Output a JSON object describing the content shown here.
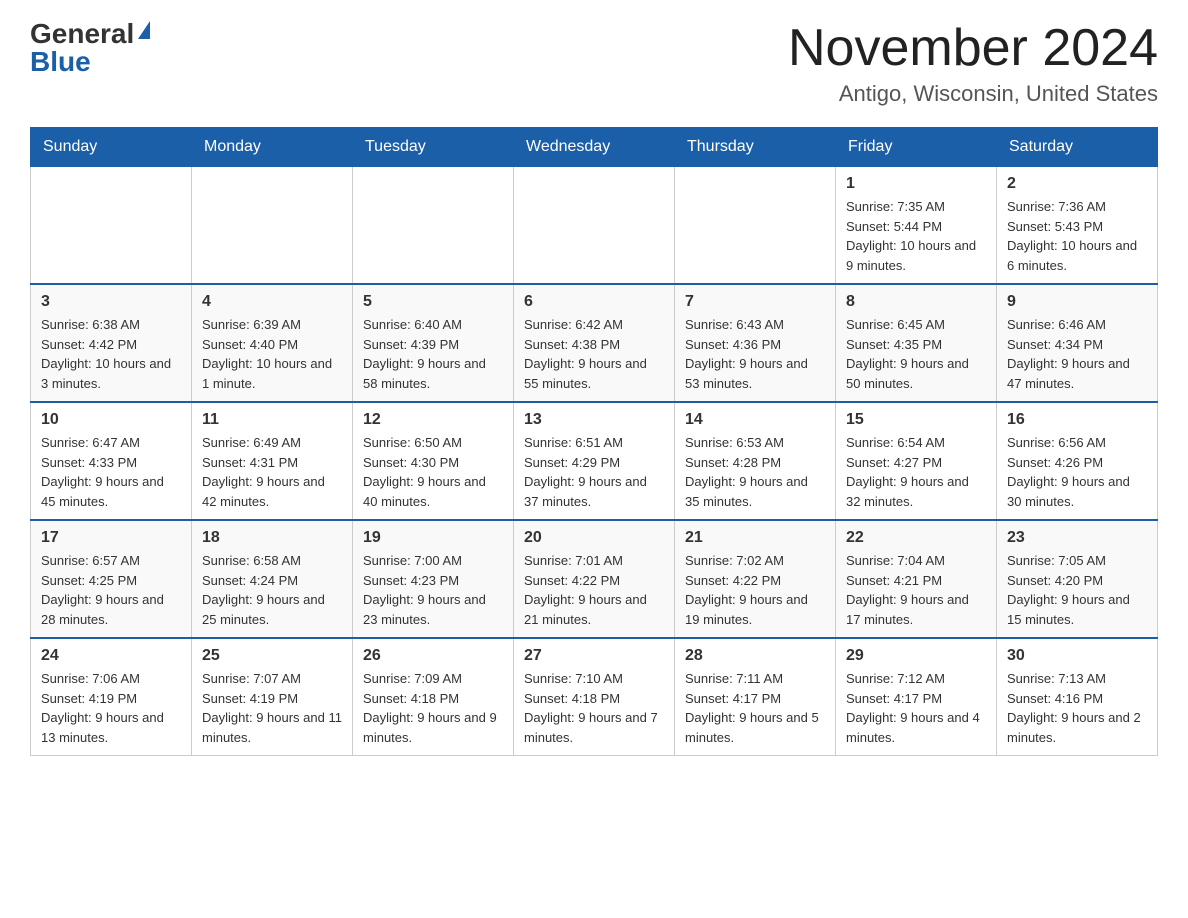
{
  "header": {
    "logo_general": "General",
    "logo_blue": "Blue",
    "month_title": "November 2024",
    "location": "Antigo, Wisconsin, United States"
  },
  "weekdays": [
    "Sunday",
    "Monday",
    "Tuesday",
    "Wednesday",
    "Thursday",
    "Friday",
    "Saturday"
  ],
  "weeks": [
    [
      {
        "day": "",
        "info": ""
      },
      {
        "day": "",
        "info": ""
      },
      {
        "day": "",
        "info": ""
      },
      {
        "day": "",
        "info": ""
      },
      {
        "day": "",
        "info": ""
      },
      {
        "day": "1",
        "info": "Sunrise: 7:35 AM\nSunset: 5:44 PM\nDaylight: 10 hours and 9 minutes."
      },
      {
        "day": "2",
        "info": "Sunrise: 7:36 AM\nSunset: 5:43 PM\nDaylight: 10 hours and 6 minutes."
      }
    ],
    [
      {
        "day": "3",
        "info": "Sunrise: 6:38 AM\nSunset: 4:42 PM\nDaylight: 10 hours and 3 minutes."
      },
      {
        "day": "4",
        "info": "Sunrise: 6:39 AM\nSunset: 4:40 PM\nDaylight: 10 hours and 1 minute."
      },
      {
        "day": "5",
        "info": "Sunrise: 6:40 AM\nSunset: 4:39 PM\nDaylight: 9 hours and 58 minutes."
      },
      {
        "day": "6",
        "info": "Sunrise: 6:42 AM\nSunset: 4:38 PM\nDaylight: 9 hours and 55 minutes."
      },
      {
        "day": "7",
        "info": "Sunrise: 6:43 AM\nSunset: 4:36 PM\nDaylight: 9 hours and 53 minutes."
      },
      {
        "day": "8",
        "info": "Sunrise: 6:45 AM\nSunset: 4:35 PM\nDaylight: 9 hours and 50 minutes."
      },
      {
        "day": "9",
        "info": "Sunrise: 6:46 AM\nSunset: 4:34 PM\nDaylight: 9 hours and 47 minutes."
      }
    ],
    [
      {
        "day": "10",
        "info": "Sunrise: 6:47 AM\nSunset: 4:33 PM\nDaylight: 9 hours and 45 minutes."
      },
      {
        "day": "11",
        "info": "Sunrise: 6:49 AM\nSunset: 4:31 PM\nDaylight: 9 hours and 42 minutes."
      },
      {
        "day": "12",
        "info": "Sunrise: 6:50 AM\nSunset: 4:30 PM\nDaylight: 9 hours and 40 minutes."
      },
      {
        "day": "13",
        "info": "Sunrise: 6:51 AM\nSunset: 4:29 PM\nDaylight: 9 hours and 37 minutes."
      },
      {
        "day": "14",
        "info": "Sunrise: 6:53 AM\nSunset: 4:28 PM\nDaylight: 9 hours and 35 minutes."
      },
      {
        "day": "15",
        "info": "Sunrise: 6:54 AM\nSunset: 4:27 PM\nDaylight: 9 hours and 32 minutes."
      },
      {
        "day": "16",
        "info": "Sunrise: 6:56 AM\nSunset: 4:26 PM\nDaylight: 9 hours and 30 minutes."
      }
    ],
    [
      {
        "day": "17",
        "info": "Sunrise: 6:57 AM\nSunset: 4:25 PM\nDaylight: 9 hours and 28 minutes."
      },
      {
        "day": "18",
        "info": "Sunrise: 6:58 AM\nSunset: 4:24 PM\nDaylight: 9 hours and 25 minutes."
      },
      {
        "day": "19",
        "info": "Sunrise: 7:00 AM\nSunset: 4:23 PM\nDaylight: 9 hours and 23 minutes."
      },
      {
        "day": "20",
        "info": "Sunrise: 7:01 AM\nSunset: 4:22 PM\nDaylight: 9 hours and 21 minutes."
      },
      {
        "day": "21",
        "info": "Sunrise: 7:02 AM\nSunset: 4:22 PM\nDaylight: 9 hours and 19 minutes."
      },
      {
        "day": "22",
        "info": "Sunrise: 7:04 AM\nSunset: 4:21 PM\nDaylight: 9 hours and 17 minutes."
      },
      {
        "day": "23",
        "info": "Sunrise: 7:05 AM\nSunset: 4:20 PM\nDaylight: 9 hours and 15 minutes."
      }
    ],
    [
      {
        "day": "24",
        "info": "Sunrise: 7:06 AM\nSunset: 4:19 PM\nDaylight: 9 hours and 13 minutes."
      },
      {
        "day": "25",
        "info": "Sunrise: 7:07 AM\nSunset: 4:19 PM\nDaylight: 9 hours and 11 minutes."
      },
      {
        "day": "26",
        "info": "Sunrise: 7:09 AM\nSunset: 4:18 PM\nDaylight: 9 hours and 9 minutes."
      },
      {
        "day": "27",
        "info": "Sunrise: 7:10 AM\nSunset: 4:18 PM\nDaylight: 9 hours and 7 minutes."
      },
      {
        "day": "28",
        "info": "Sunrise: 7:11 AM\nSunset: 4:17 PM\nDaylight: 9 hours and 5 minutes."
      },
      {
        "day": "29",
        "info": "Sunrise: 7:12 AM\nSunset: 4:17 PM\nDaylight: 9 hours and 4 minutes."
      },
      {
        "day": "30",
        "info": "Sunrise: 7:13 AM\nSunset: 4:16 PM\nDaylight: 9 hours and 2 minutes."
      }
    ]
  ]
}
